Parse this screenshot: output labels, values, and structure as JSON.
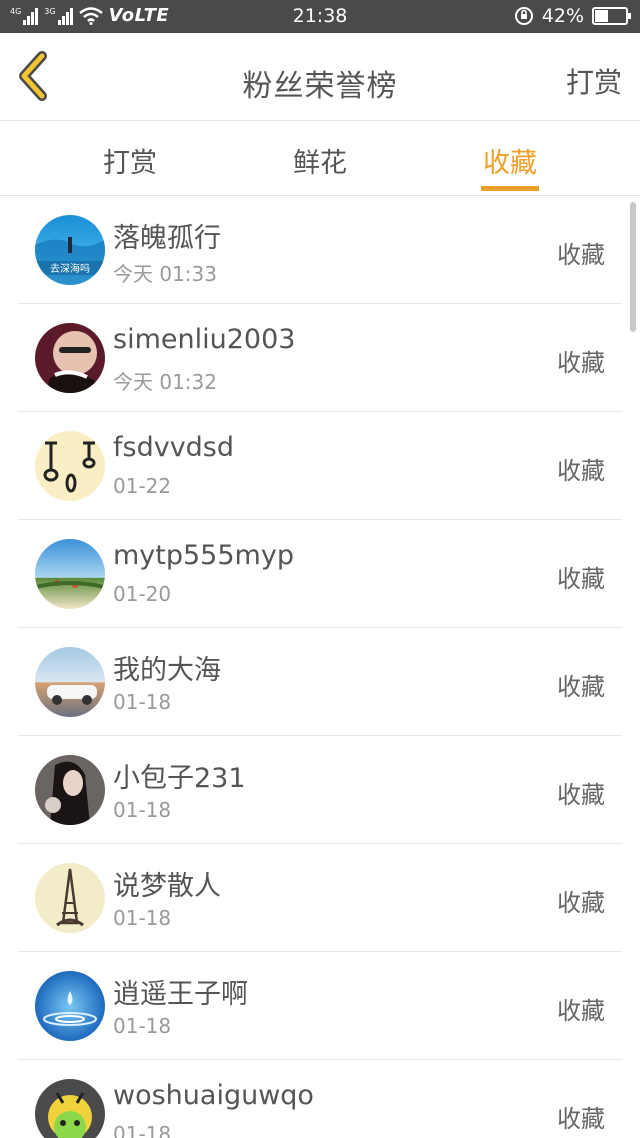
{
  "status_bar": {
    "signal_left": "4G",
    "signal_right": "3G",
    "network": "VoLTE",
    "time": "21:38",
    "battery_percent_text": "42%",
    "battery_level": 0.42
  },
  "header": {
    "title": "粉丝荣誉榜",
    "action_label": "打赏"
  },
  "tabs": [
    {
      "label": "打赏",
      "active": false
    },
    {
      "label": "鲜花",
      "active": false
    },
    {
      "label": "收藏",
      "active": true
    }
  ],
  "accent_color": "#f0a028",
  "list": [
    {
      "name": "落魄孤行",
      "date": "今天 01:33",
      "action": "收藏",
      "avatar_text": "去深海吗"
    },
    {
      "name": "simenliu2003",
      "date": "今天 01:32",
      "action": "收藏"
    },
    {
      "name": "fsdvvdsd",
      "date": "01-22",
      "action": "收藏"
    },
    {
      "name": "mytp555myp",
      "date": "01-20",
      "action": "收藏"
    },
    {
      "name": "我的大海",
      "date": "01-18",
      "action": "收藏"
    },
    {
      "name": "小包子231",
      "date": "01-18",
      "action": "收藏"
    },
    {
      "name": "说梦散人",
      "date": "01-18",
      "action": "收藏"
    },
    {
      "name": "逍遥王子啊",
      "date": "01-18",
      "action": "收藏"
    },
    {
      "name": "woshuaiguwqo",
      "date": "01-18",
      "action": "收藏"
    }
  ]
}
